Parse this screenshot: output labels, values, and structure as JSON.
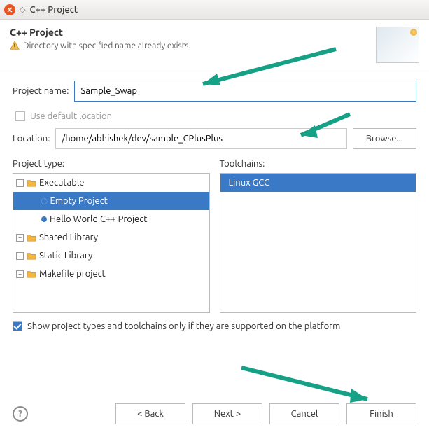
{
  "titlebar": {
    "title": "C++ Project"
  },
  "header": {
    "title": "C++ Project",
    "message": "Directory with specified name already exists."
  },
  "form": {
    "project_name_label": "Project name:",
    "project_name_value": "Sample_Swap",
    "use_default_label": "Use default location",
    "use_default_checked": false,
    "location_label": "Location:",
    "location_value": "/home/abhishek/dev/sample_CPlusPlus",
    "browse_label": "Browse..."
  },
  "project_type": {
    "label": "Project type:",
    "tree": [
      {
        "label": "Executable",
        "level": 0,
        "expanded": true,
        "icon": "folder",
        "selected": false
      },
      {
        "label": "Empty Project",
        "level": 1,
        "icon": "dot",
        "selected": true
      },
      {
        "label": "Hello World C++ Project",
        "level": 1,
        "icon": "bullet",
        "selected": false
      },
      {
        "label": "Shared Library",
        "level": 0,
        "expanded": false,
        "icon": "folder",
        "selected": false
      },
      {
        "label": "Static Library",
        "level": 0,
        "expanded": false,
        "icon": "folder",
        "selected": false
      },
      {
        "label": "Makefile project",
        "level": 0,
        "expanded": false,
        "icon": "folder",
        "selected": false
      }
    ]
  },
  "toolchains": {
    "label": "Toolchains:",
    "items": [
      {
        "label": "Linux GCC",
        "selected": true
      }
    ]
  },
  "platform_check": {
    "label": "Show project types and toolchains only if they are supported on the platform",
    "checked": true
  },
  "footer": {
    "help_label": "?",
    "back": "< Back",
    "next": "Next >",
    "cancel": "Cancel",
    "finish": "Finish"
  }
}
